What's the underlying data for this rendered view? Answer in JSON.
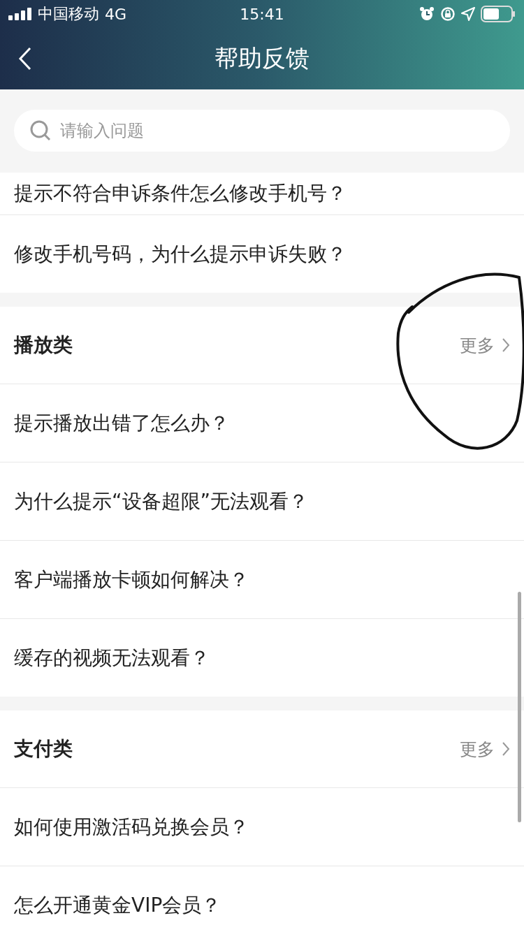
{
  "status_bar": {
    "carrier": "中国移动",
    "network": "4G",
    "time": "15:41"
  },
  "nav": {
    "title": "帮助反馈"
  },
  "search": {
    "placeholder": "请输入问题"
  },
  "sections": [
    {
      "items": [
        "提示不符合申诉条件怎么修改手机号？",
        "修改手机号码，为什么提示申诉失败？"
      ]
    },
    {
      "title": "播放类",
      "more": "更多",
      "items": [
        "提示播放出错了怎么办？",
        "为什么提示“设备超限”无法观看？",
        "客户端播放卡顿如何解决？",
        "缓存的视频无法观看？"
      ]
    },
    {
      "title": "支付类",
      "more": "更多",
      "items": [
        "如何使用激活码兑换会员？",
        "怎么开通黄金VIP会员？"
      ]
    }
  ]
}
